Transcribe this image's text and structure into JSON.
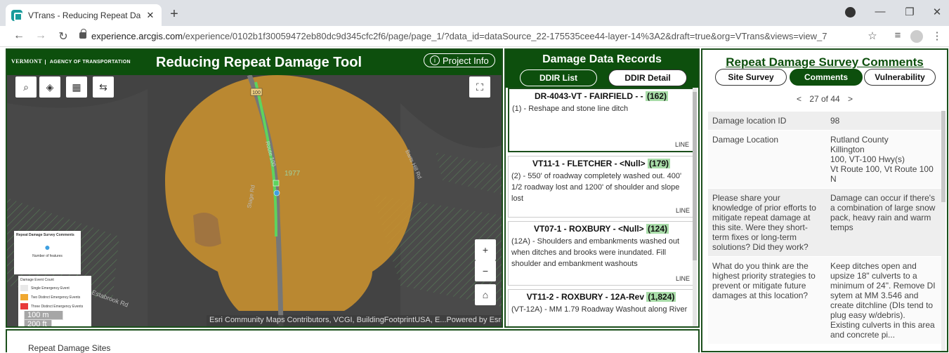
{
  "browser": {
    "tab_title": "VTrans - Reducing Repeat Damag",
    "url_host": "experience.arcgis.com",
    "url_path": "/experience/0102b1f30059472eb80dc9d345cfc2f6/page/page_1/?data_id=dataSource_22-175535cee44-layer-14%3A2&draft=true&org=VTrans&views=view_7"
  },
  "map": {
    "logo_text": "VERMONT",
    "logo_agency": "AGENCY OF TRANSPORTATION",
    "title": "Reducing Repeat Damage Tool",
    "project_info": "Project Info",
    "route_shield": "100",
    "road_labels": [
      "Route 100",
      "Barts Hill Rd",
      "Stage Rd",
      "Estabrook Rd"
    ],
    "year_label": "1977",
    "legend": {
      "title": "Repeat Damage Survey Comments",
      "count_label": "Number of features",
      "event_title": "Damage Event Count",
      "items": [
        {
          "label": "Single Emergency Event",
          "color": "#e8e8e8"
        },
        {
          "label": "Two Distinct Emergency Events",
          "color": "#f0a830"
        },
        {
          "label": "Three Distinct Emergency Events",
          "color": "#e83a3a"
        }
      ]
    },
    "scale_m": "100 m",
    "scale_ft": "200 ft",
    "attribution": "Esri Community Maps Contributors, VCGI, BuildingFootprintUSA, E...",
    "powered_by": "Powered by Esri"
  },
  "records": {
    "title": "Damage Data Records",
    "tab_list": "DDIR List",
    "tab_detail": "DDIR Detail",
    "items": [
      {
        "title": "DR-4043-VT - FAIRFIELD - -",
        "count": "(162)",
        "desc": "(1) - Reshape and stone line ditch",
        "type": "LINE"
      },
      {
        "title": "VT11-1 - FLETCHER - <Null>",
        "count": "(179)",
        "desc": "(2) - 550' of roadway completely washed out. 400' 1/2 roadway lost and 1200' of shoulder and slope lost",
        "type": "LINE"
      },
      {
        "title": "VT07-1 - ROXBURY - <Null>",
        "count": "(124)",
        "desc": "(12A) - Shoulders and embankments washed out when ditches and brooks were inundated. Fill shoulder and embankment washouts",
        "type": "LINE"
      },
      {
        "title": "VT11-2 - ROXBURY - 12A-Rev",
        "count": "(1,824)",
        "desc": "(VT-12A) - MM 1.79 Roadway Washout along River",
        "type": ""
      }
    ]
  },
  "survey": {
    "title": "Repeat Damage Survey Comments",
    "tab_site": "Site Survey",
    "tab_comments": "Comments",
    "tab_vuln": "Vulnerability",
    "pager_prev": "<",
    "pager_text": "27 of 44",
    "pager_next": ">",
    "rows": [
      {
        "key": "Damage location ID",
        "value": "98"
      },
      {
        "key": "Damage Location",
        "value": "Rutland County\nKillington\n100, VT-100 Hwy(s)\nVt Route 100, Vt Route 100 N"
      },
      {
        "key": "Please share your knowledge of prior efforts to mitigate repeat damage at this site. Were they short-term fixes or long-term solutions? Did they work?",
        "value": "Damage can occur if there's a combination of large snow pack, heavy rain and warm temps"
      },
      {
        "key": "What do you think are the highest priority strategies to prevent or mitigate future damages at this location?",
        "value": "Keep ditches open and upsize 18\" culverts to a minimum of 24\". Remove DI sytem at MM 3.546 and create ditchline (DIs tend to plug easy w/debris). Existing culverts in this area and concrete pi..."
      }
    ]
  },
  "bottom": {
    "title": "Repeat Damage Sites"
  },
  "colors": {
    "brand_green": "#0d4f0d",
    "count_highlight": "#a8dca8",
    "buffer_orange": "#c89030"
  }
}
